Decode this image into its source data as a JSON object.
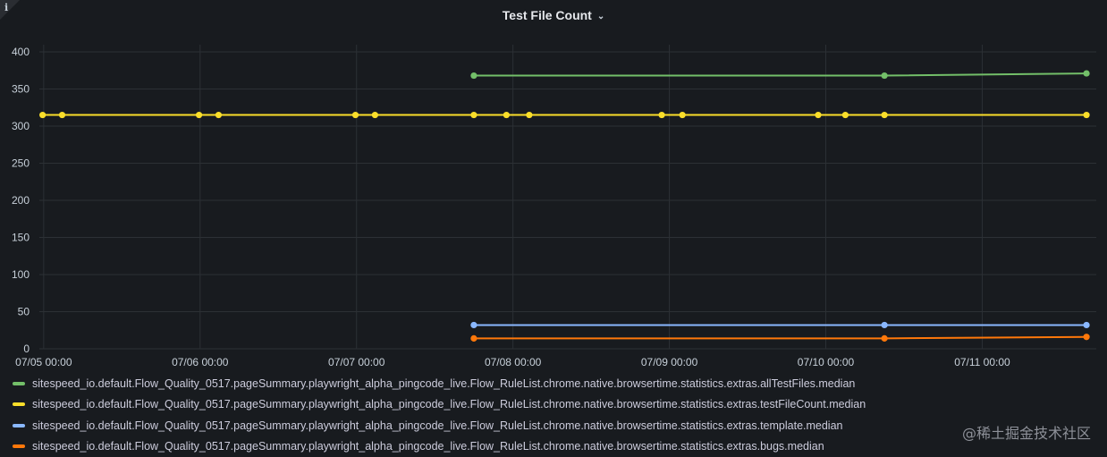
{
  "panel": {
    "title": "Test File Count",
    "title_chevron": "⌄",
    "info_icon": "i",
    "watermark": "@稀土掘金技术社区"
  },
  "chart_data": {
    "type": "line",
    "title": "Test File Count",
    "xlabel": "",
    "ylabel": "",
    "ylim": [
      0,
      400
    ],
    "yticks": [
      0,
      50,
      100,
      150,
      200,
      250,
      300,
      350,
      400
    ],
    "xlim": [
      "07/04 23:20",
      "07/11 17:30"
    ],
    "xticks": [
      "07/05 00:00",
      "07/06 00:00",
      "07/07 00:00",
      "07/08 00:00",
      "07/09 00:00",
      "07/10 00:00",
      "07/11 00:00"
    ],
    "grid": true,
    "legend_position": "bottom",
    "series": [
      {
        "name": "sitespeed_io.default.Flow_Quality_0517.pageSummary.playwright_alpha_pingcode_live.Flow_RuleList.chrome.native.browsertime.statistics.extras.allTestFiles.median",
        "color": "#73bf69",
        "x": [
          "07/07 18:00",
          "07/10 09:00",
          "07/11 16:00"
        ],
        "y": [
          368,
          368,
          371
        ]
      },
      {
        "name": "sitespeed_io.default.Flow_Quality_0517.pageSummary.playwright_alpha_pingcode_live.Flow_RuleList.chrome.native.browsertime.statistics.extras.testFileCount.median",
        "color": "#fade2a",
        "x": [
          "07/04 23:50",
          "07/05 02:50",
          "07/05 23:50",
          "07/06 02:50",
          "07/06 23:50",
          "07/07 02:50",
          "07/07 18:00",
          "07/07 23:00",
          "07/08 02:30",
          "07/08 22:50",
          "07/09 02:00",
          "07/09 22:50",
          "07/10 03:00",
          "07/10 09:00",
          "07/11 16:00"
        ],
        "y": [
          315,
          315,
          315,
          315,
          315,
          315,
          315,
          315,
          315,
          315,
          315,
          315,
          315,
          315,
          315
        ]
      },
      {
        "name": "sitespeed_io.default.Flow_Quality_0517.pageSummary.playwright_alpha_pingcode_live.Flow_RuleList.chrome.native.browsertime.statistics.extras.template.median",
        "color": "#8ab8ff",
        "x": [
          "07/07 18:00",
          "07/10 09:00",
          "07/11 16:00"
        ],
        "y": [
          32,
          32,
          32
        ]
      },
      {
        "name": "sitespeed_io.default.Flow_Quality_0517.pageSummary.playwright_alpha_pingcode_live.Flow_RuleList.chrome.native.browsertime.statistics.extras.bugs.median",
        "color": "#ff780a",
        "x": [
          "07/07 18:00",
          "07/10 09:00",
          "07/11 16:00"
        ],
        "y": [
          14,
          14,
          16
        ]
      }
    ]
  }
}
